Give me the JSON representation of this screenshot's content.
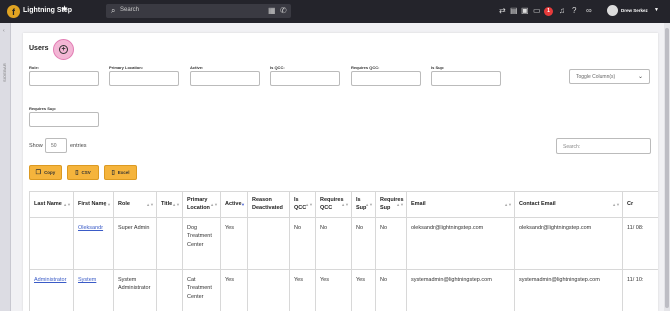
{
  "topbar": {
    "brand": "Lightning Step",
    "logo_letter": "f",
    "search_placeholder": "Search",
    "notification_count": "1",
    "user_name": "Drew Serkez"
  },
  "sidebar": {
    "collapsed_label": "SIDEBAR"
  },
  "page": {
    "title": "Users"
  },
  "filters": [
    {
      "label": "Role:",
      "value": ""
    },
    {
      "label": "Primary Location:",
      "value": ""
    },
    {
      "label": "Active:",
      "value": ""
    },
    {
      "label": "Is QCC:",
      "value": ""
    },
    {
      "label": "Requires QCC:",
      "value": ""
    },
    {
      "label": "Is Sup:",
      "value": ""
    },
    {
      "label": "Requires Sup:",
      "value": ""
    }
  ],
  "toggle_columns": "Toggle Column(s)",
  "length": {
    "show": "Show",
    "value": "50",
    "entries": "entries"
  },
  "table_search_placeholder": "Search:",
  "export_buttons": {
    "copy": "Copy",
    "csv": "CSV",
    "excel": "Excel"
  },
  "table": {
    "headers": [
      "Last Name",
      "First Name",
      "Role",
      "Title",
      "Primary Location",
      "Active",
      "Reason Deactivated",
      "Is QCC",
      "Requires QCC",
      "Is Sup",
      "Requires Sup",
      "Email",
      "Contact Email",
      "Cr"
    ],
    "rows": [
      [
        "",
        "Oleksandr",
        "Super Admin",
        "",
        "Dog Treatment Center",
        "Yes",
        "",
        "No",
        "No",
        "No",
        "No",
        "oleksandr@lightningstep.com",
        "oleksandr@lightningstep.com",
        "11/ 08:"
      ],
      [
        "Administrator",
        "System",
        "System Administrator",
        "",
        "Cat Treatment Center",
        "Yes",
        "",
        "Yes",
        "Yes",
        "Yes",
        "No",
        "systemadmin@lightningstep.com",
        "systemadmin@lightningstep.com",
        "11/ 10:"
      ]
    ]
  }
}
